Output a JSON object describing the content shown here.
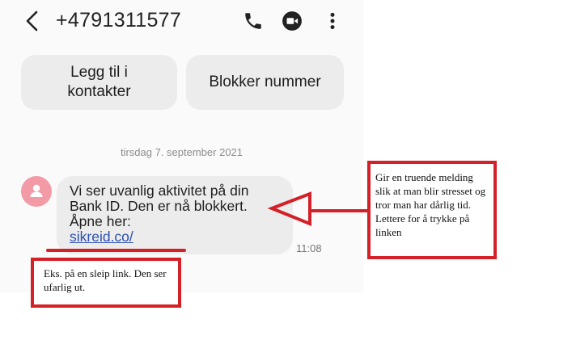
{
  "header": {
    "phone_number": "+4791311577",
    "icons": [
      "back-arrow-icon",
      "phone-icon",
      "video-call-icon",
      "more-vert-icon"
    ]
  },
  "actions": {
    "add_contact_line1": "Legg til i",
    "add_contact_line2": "kontakter",
    "block_number": "Blokker nummer"
  },
  "conversation": {
    "date": "tirsdag 7. september 2021",
    "message": {
      "line1": "Vi ser uvanlig aktivitet på din",
      "line2": "Bank ID. Den er nå blokkert.",
      "line3": "Åpne her:",
      "link": "sikreid.co/",
      "time": "11:08"
    }
  },
  "annotations": {
    "right_note": "Gir en truende melding slik at man blir stresset og tror man har dårlig tid. Lettere for å trykke på linken",
    "left_note": "Eks. på en sleip link. Den ser ufarlig ut."
  },
  "colors": {
    "annotation_red": "#d42027",
    "bubble_bg": "#ececec",
    "avatar_pink": "#f29aa6",
    "link_blue": "#2b4fb3"
  }
}
